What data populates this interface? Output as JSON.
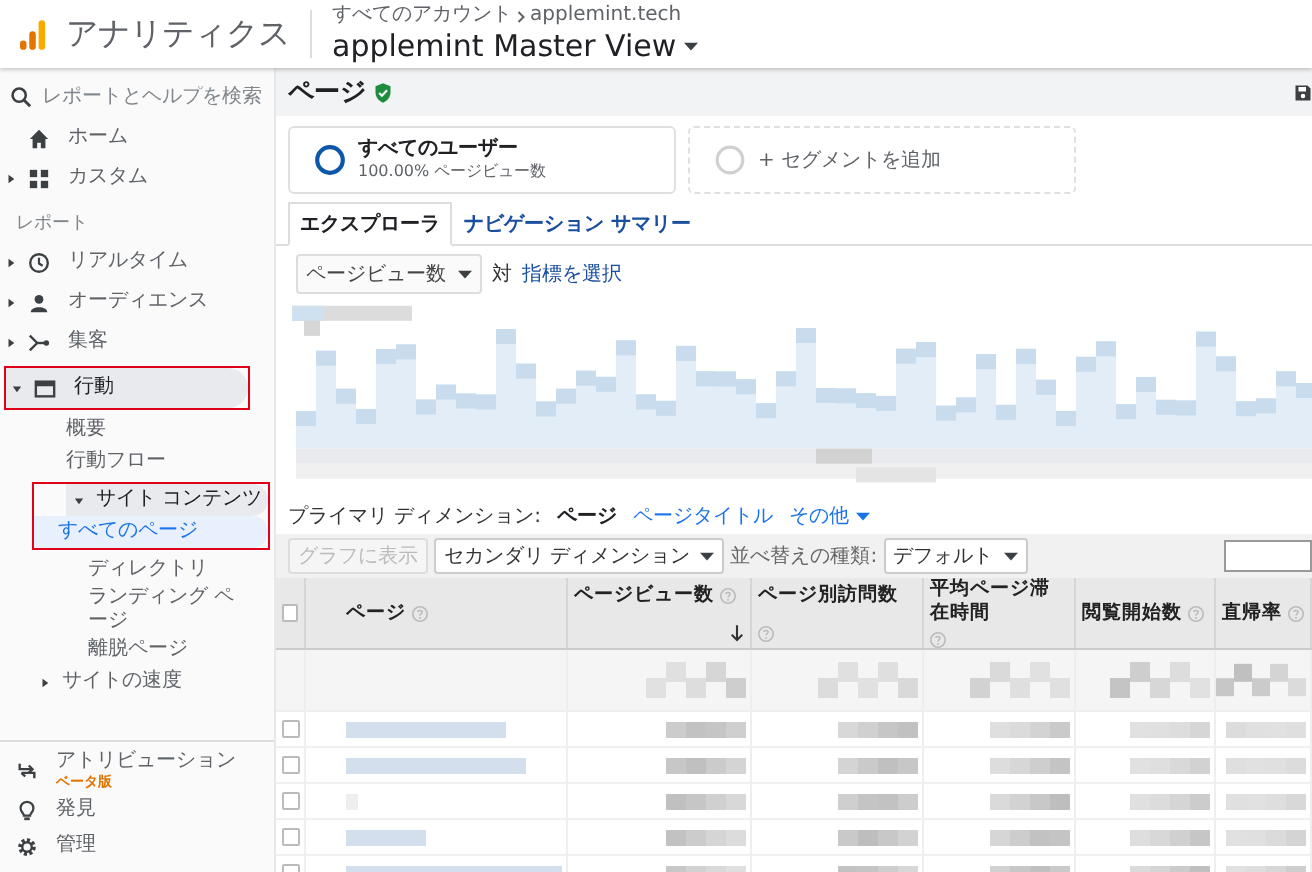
{
  "header": {
    "app_name": "アナリティクス",
    "breadcrumb": [
      "すべてのアカウント",
      "applemint.tech"
    ],
    "view_name": "applemint Master View"
  },
  "sidebar": {
    "search": {
      "placeholder": "レポートとヘルプを検索"
    },
    "items": [
      {
        "label": "ホーム",
        "selected": false
      },
      {
        "label": "カスタム",
        "selected": false,
        "expanded": false
      }
    ],
    "section_label": "レポート",
    "reports": [
      {
        "label": "リアルタイム",
        "selected": false,
        "expanded": false,
        "highlighted": false
      },
      {
        "label": "オーディエンス",
        "selected": false,
        "expanded": false,
        "highlighted": false
      },
      {
        "label": "集客",
        "selected": false,
        "expanded": false,
        "highlighted": false
      },
      {
        "label": "行動",
        "selected": true,
        "expanded": true,
        "highlighted": true,
        "children": [
          {
            "label": "概要",
            "selected": false,
            "highlighted": false
          },
          {
            "label": "行動フロー",
            "selected": false,
            "highlighted": false
          },
          {
            "label": "サイト コンテンツ",
            "selected": true,
            "expanded": true,
            "highlighted": true,
            "children": [
              {
                "label": "すべてのページ",
                "selected": true,
                "highlighted": false
              },
              {
                "label": "ディレクトリ",
                "selected": false,
                "highlighted": false
              },
              {
                "label": "ランディング ページ",
                "selected": false,
                "highlighted": false
              },
              {
                "label": "離脱ページ",
                "selected": false,
                "highlighted": false
              }
            ]
          },
          {
            "label": "サイトの速度",
            "selected": false,
            "expanded": false,
            "highlighted": false
          }
        ]
      }
    ],
    "bottom": [
      {
        "label": "アトリビューション",
        "badge": "ベータ版"
      },
      {
        "label": "発見"
      },
      {
        "label": "管理"
      }
    ]
  },
  "page": {
    "title": "ページ",
    "verified": true
  },
  "segments": [
    {
      "kind": "segment",
      "title": "すべてのユーザー",
      "subtitle": "100.00% ページビュー数"
    },
    {
      "kind": "add",
      "label": "+ セグメントを追加"
    }
  ],
  "tabs": [
    {
      "label": "エクスプローラ",
      "selected": true
    },
    {
      "label": "ナビゲーション サマリー",
      "selected": false
    }
  ],
  "metric": {
    "select": "ページビュー数",
    "versus": "対",
    "link": "指標を選択"
  },
  "dimension": {
    "label": "プライマリ ディメンション:",
    "options": [
      {
        "label": "ページ",
        "selected": true,
        "kind": "link"
      },
      {
        "label": "ページタイトル",
        "selected": false,
        "kind": "link"
      },
      {
        "label": "その他",
        "selected": false,
        "kind": "menu"
      }
    ]
  },
  "toolbar": {
    "chart_button": {
      "label": "グラフに表示",
      "disabled": true
    },
    "secondary": "セカンダリ ディメンション",
    "sort_label": "並べ替えの種類:",
    "sort_value": "デフォルト"
  },
  "table": {
    "columns": [
      {
        "label": "ページ",
        "sorted": false
      },
      {
        "label": "ページビュー数",
        "sorted": true
      },
      {
        "label": "ページ別訪問数",
        "sorted": false
      },
      {
        "label": "平均ページ滞在時間",
        "sorted": false
      },
      {
        "label": "閲覧開始数",
        "sorted": false
      },
      {
        "label": "直帰率",
        "sorted": false
      }
    ],
    "select_all": {
      "checked": false
    },
    "rows": [
      {
        "checked": false
      },
      {
        "checked": false
      },
      {
        "checked": false
      },
      {
        "checked": false
      },
      {
        "checked": false
      }
    ]
  }
}
